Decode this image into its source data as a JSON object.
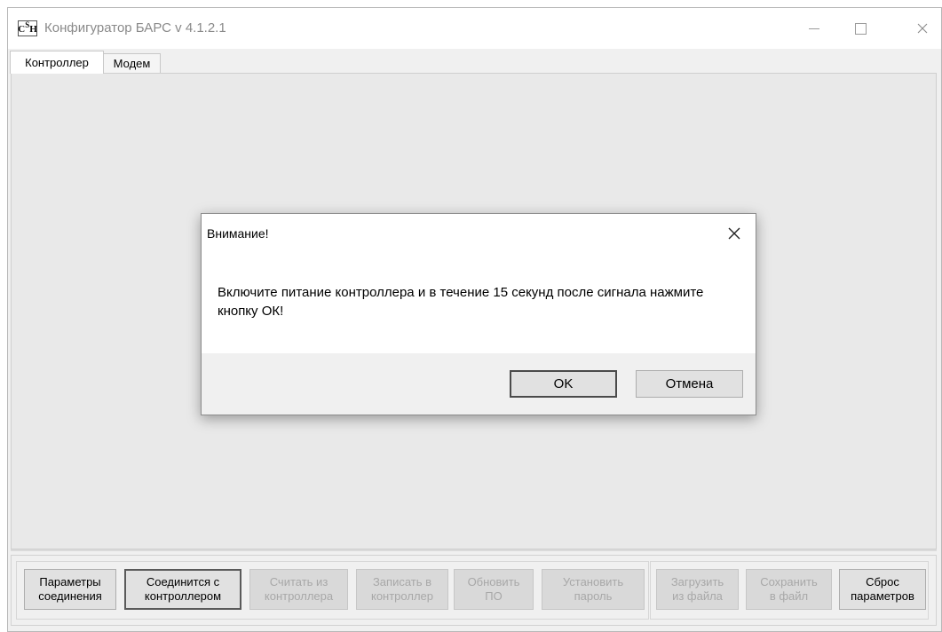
{
  "window": {
    "logo_text": "CSH",
    "title": "Конфигуратор БАРС v 4.1.2.1",
    "minimize_label": "",
    "maximize_label": "",
    "close_label": "✕"
  },
  "tabs": [
    {
      "label": "Контроллер",
      "active": true
    },
    {
      "label": "Модем",
      "active": false
    }
  ],
  "toolbar": {
    "buttons": [
      {
        "label": "Параметры\nсоединения",
        "enabled": true
      },
      {
        "label": "Соединится с\nконтроллером",
        "enabled": true,
        "default": true
      },
      {
        "label": "Считать из\nконтроллера",
        "enabled": false
      },
      {
        "label": "Записать в\nконтроллер",
        "enabled": false
      },
      {
        "label": "Обновить\nПО",
        "enabled": false
      },
      {
        "label": "Установить\nпароль",
        "enabled": false
      },
      {
        "label": "Загрузить\nиз файла",
        "enabled": false
      },
      {
        "label": "Сохранить\nв файл",
        "enabled": false
      },
      {
        "label": "Сброс\nпараметров",
        "enabled": true
      }
    ]
  },
  "dialog": {
    "title": "Внимание!",
    "close_label": "✕",
    "message": "Включите питание контроллера и в течение 15 секунд после сигнала нажмите кнопку ОК!",
    "ok_label": "OK",
    "cancel_label": "Отмена"
  },
  "colors": {
    "window_bg": "#f0f0f0",
    "content_bg": "#e9e9e9",
    "disabled_text": "#a8a8a8"
  }
}
